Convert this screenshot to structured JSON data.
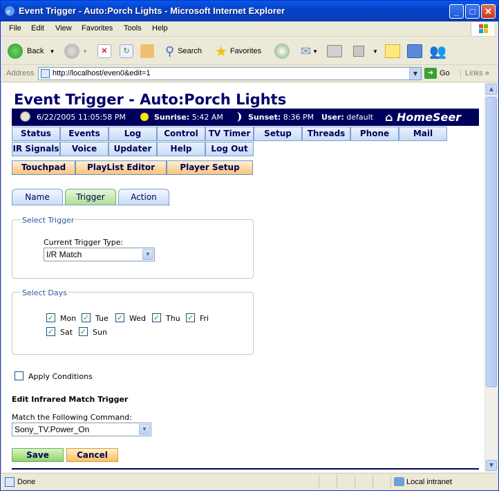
{
  "window": {
    "title": "Event Trigger - Auto:Porch Lights - Microsoft Internet Explorer"
  },
  "menu": [
    "File",
    "Edit",
    "View",
    "Favorites",
    "Tools",
    "Help"
  ],
  "toolbar": {
    "back": "Back",
    "search": "Search",
    "favorites": "Favorites"
  },
  "address": {
    "label": "Address",
    "url": "http://localhost/even0&edit=1",
    "go": "Go",
    "links": "Links"
  },
  "page": {
    "title": "Event Trigger - Auto:Porch Lights",
    "info": {
      "datetime": "6/22/2005 11:05:58 PM",
      "sunrise_label": "Sunrise:",
      "sunrise": "5:42 AM",
      "sunset_label": "Sunset:",
      "sunset": "8:36 PM",
      "user_label": "User:",
      "user": "default",
      "logo": "HomeSeer"
    },
    "nav_row1": [
      "Status",
      "Events",
      "Log",
      "Control",
      "TV Timer",
      "Setup",
      "Threads",
      "Phone",
      "Mail"
    ],
    "nav_row2": [
      "IR Signals",
      "Voice",
      "Updater",
      "Help",
      "Log Out"
    ],
    "nav_row3": [
      "Touchpad",
      "PlayList Editor",
      "Player Setup"
    ],
    "tabs": [
      "Name",
      "Trigger",
      "Action"
    ],
    "select_trigger": {
      "legend": "Select Trigger",
      "label": "Current Trigger Type:",
      "value": "I/R Match"
    },
    "select_days": {
      "legend": "Select Days",
      "days": [
        "Mon",
        "Tue",
        "Wed",
        "Thu",
        "Fri",
        "Sat",
        "Sun"
      ],
      "checked": [
        true,
        true,
        true,
        true,
        true,
        true,
        true
      ]
    },
    "apply_conditions": "Apply Conditions",
    "ir_heading": "Edit Infrared Match Trigger",
    "match_label": "Match the Following Command:",
    "match_value": "Sony_TV.Power_On",
    "save": "Save",
    "cancel": "Cancel"
  },
  "status": {
    "text": "Done",
    "zone": "Local intranet"
  }
}
